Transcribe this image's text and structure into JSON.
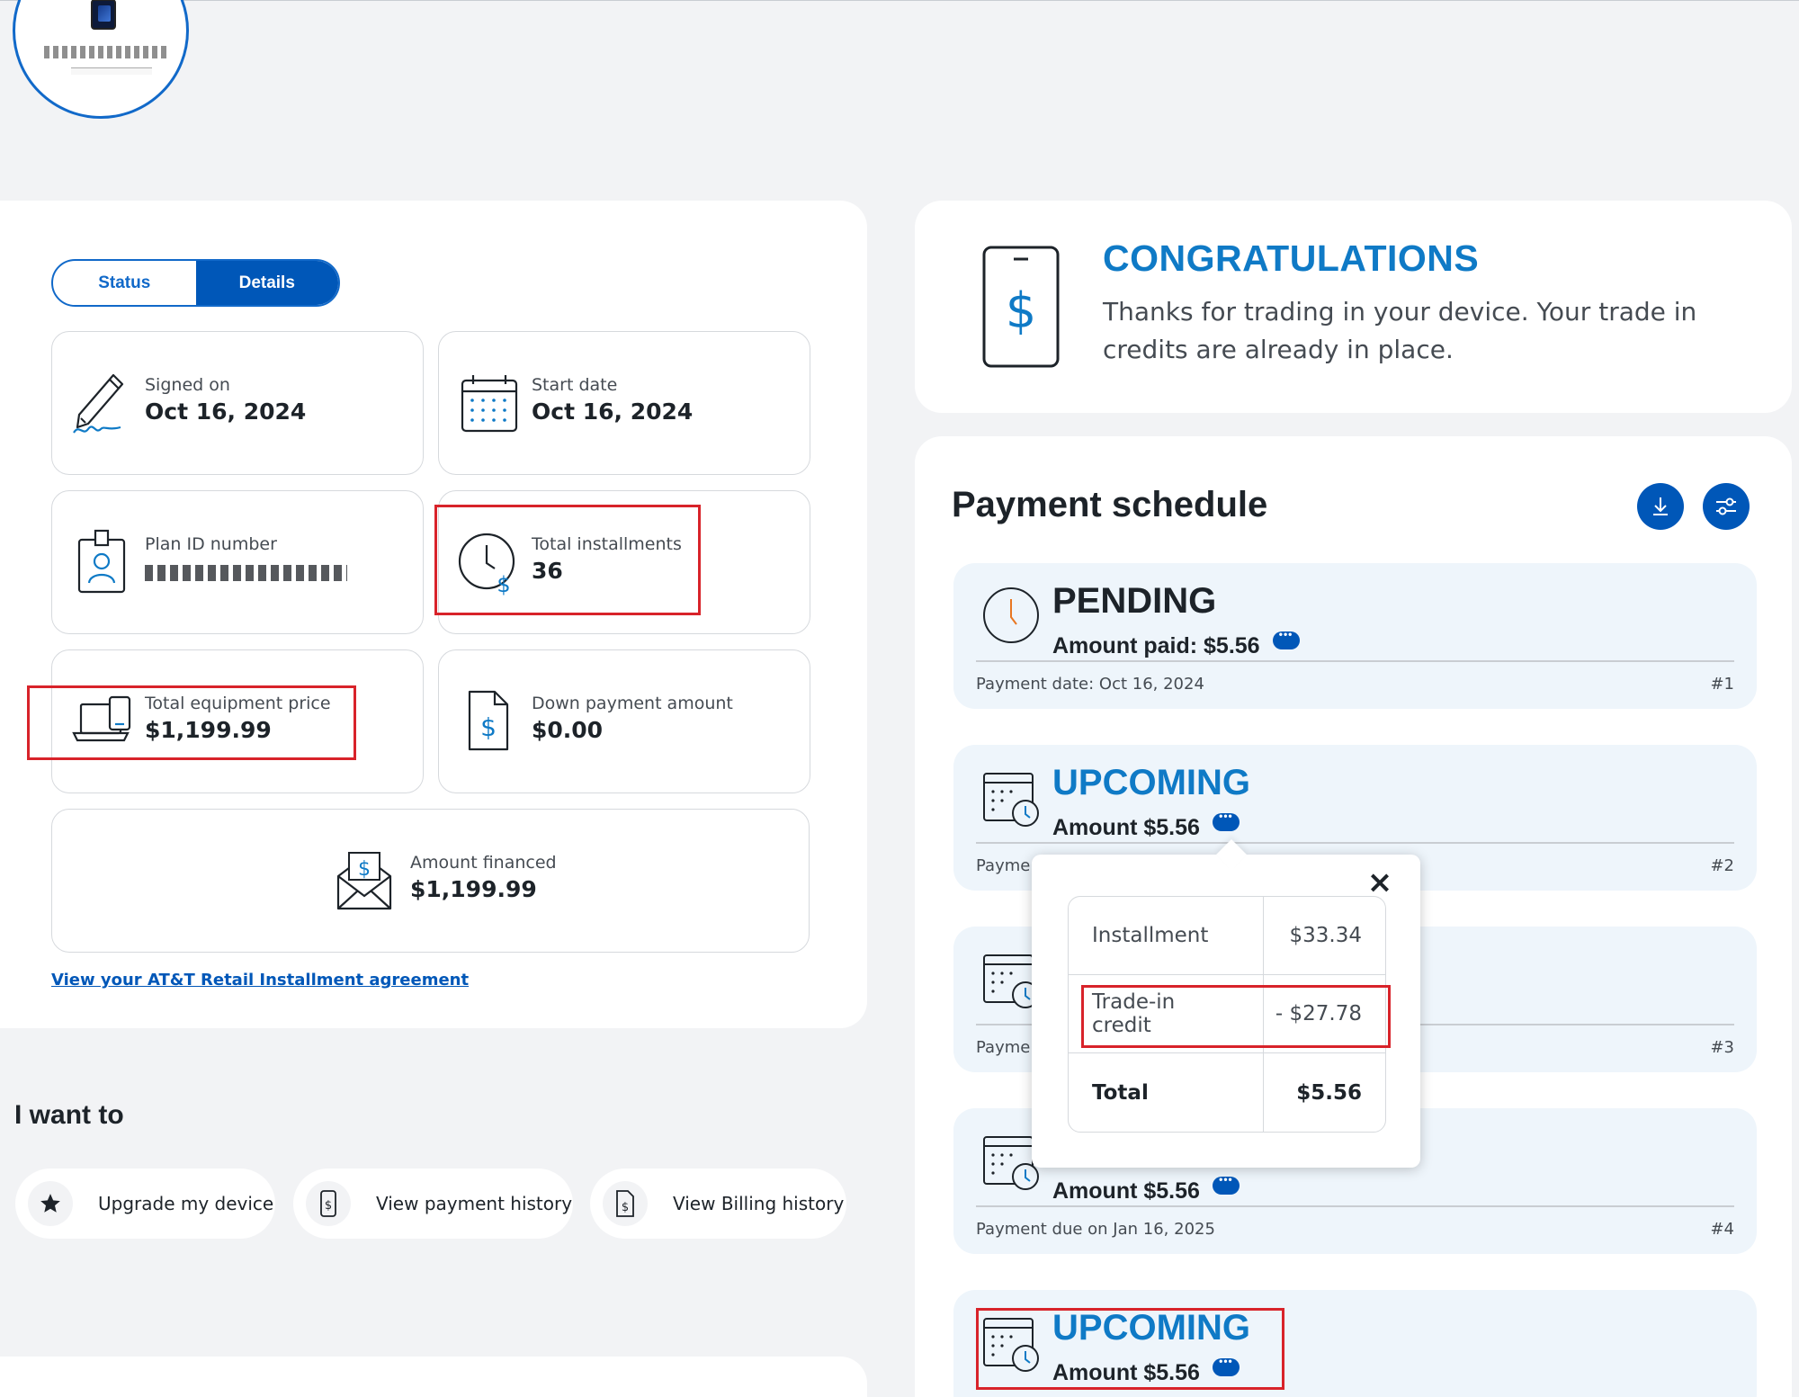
{
  "device": {
    "phone_number_masked": "",
    "label_masked": ""
  },
  "toggle": {
    "status_label": "Status",
    "details_label": "Details",
    "active": "Details"
  },
  "details": {
    "signed_on": {
      "label": "Signed on",
      "value": "Oct 16, 2024",
      "icon": "pen-signature-icon"
    },
    "start_date": {
      "label": "Start date",
      "value": "Oct 16, 2024",
      "icon": "calendar-icon"
    },
    "plan_id": {
      "label": "Plan ID number",
      "value_masked": true,
      "icon": "id-badge-icon"
    },
    "total_installments": {
      "label": "Total installments",
      "value": "36",
      "icon": "clock-dollar-icon"
    },
    "total_equipment_price": {
      "label": "Total equipment price",
      "value": "$1,199.99",
      "icon": "laptop-phone-icon"
    },
    "down_payment": {
      "label": "Down payment amount",
      "value": "$0.00",
      "icon": "document-dollar-icon"
    },
    "amount_financed": {
      "label": "Amount financed",
      "value": "$1,199.99",
      "icon": "envelope-dollar-icon"
    },
    "agreement_link": "View your AT&T Retail Installment agreement"
  },
  "i_want_to": {
    "title": "I want to",
    "actions": [
      {
        "label": "Upgrade my device",
        "icon": "star-icon"
      },
      {
        "label": "View payment history",
        "icon": "phone-dollar-icon"
      },
      {
        "label": "View Billing history",
        "icon": "document-dollar-icon"
      }
    ]
  },
  "congrats": {
    "title": "CONGRATULATIONS",
    "text": "Thanks for trading in your device. Your trade in credits are already in place."
  },
  "schedule": {
    "title": "Payment schedule",
    "download_icon": "download-icon",
    "filter_icon": "sliders-icon",
    "rows": [
      {
        "status": "PENDING",
        "amount": "Amount paid: $5.56",
        "date": "Payment date: Oct 16, 2024",
        "num": "#1"
      },
      {
        "status": "UPCOMING",
        "amount": "Amount $5.56",
        "date": "Payme",
        "num": "#2"
      },
      {
        "status": "",
        "amount": "",
        "date": "Payme",
        "num": "#3"
      },
      {
        "status": "",
        "amount": "Amount $5.56",
        "date": "Payment due on Jan 16, 2025",
        "num": "#4"
      },
      {
        "status": "UPCOMING",
        "amount": "Amount $5.56",
        "date": "",
        "num": ""
      }
    ]
  },
  "popover": {
    "close_icon": "close-icon",
    "rows": [
      {
        "label": "Installment",
        "amount": "$33.34"
      },
      {
        "label": "Trade-in credit",
        "amount": "- $27.78"
      },
      {
        "label": "Total",
        "amount": "$5.56"
      }
    ]
  },
  "colors": {
    "primary": "#0057b8",
    "accent_blue": "#0f7ac6",
    "highlight_red": "#d8232a",
    "background": "#f2f3f5",
    "row_background": "#eef5fb"
  }
}
